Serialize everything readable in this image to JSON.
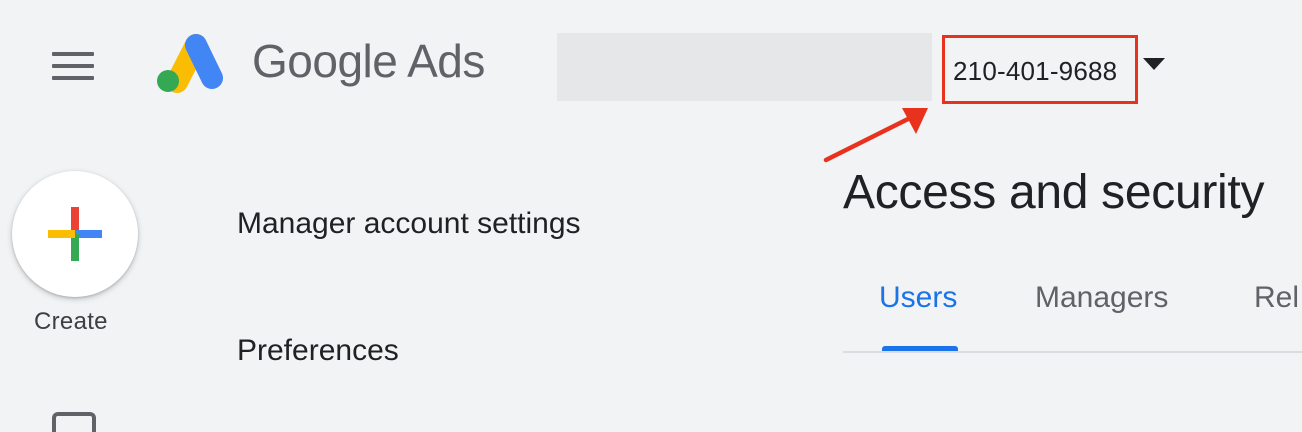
{
  "header": {
    "brand_name": "Google Ads",
    "account_id": "210-401-9688"
  },
  "sidebar": {
    "create_label": "Create",
    "items": [
      {
        "label": "Manager account settings"
      },
      {
        "label": "Preferences"
      }
    ]
  },
  "main": {
    "title": "Access and security",
    "tabs": [
      {
        "label": "Users",
        "active": true
      },
      {
        "label": "Managers",
        "active": false
      },
      {
        "label": "Rel",
        "active": false
      }
    ]
  },
  "colors": {
    "accent": "#1a73e8",
    "highlight": "#e8321e",
    "background": "#f1f3f4"
  }
}
